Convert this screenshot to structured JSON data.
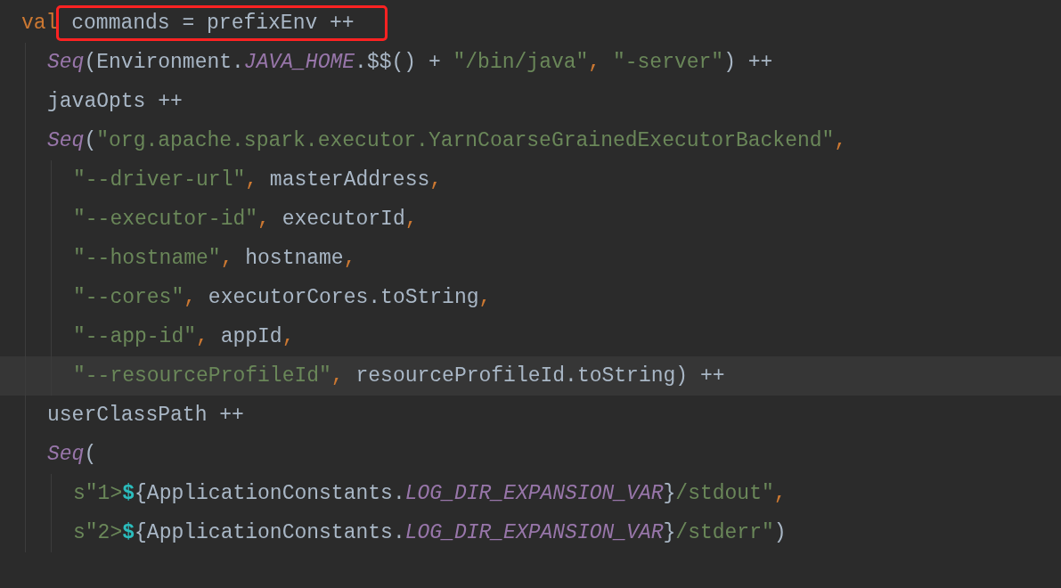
{
  "editor": {
    "lines": [
      {
        "tokens": [
          {
            "kind": "kw",
            "text": "val"
          },
          {
            "kind": "plain",
            "text": " commands = prefixEnv ++",
            "boxed": true
          }
        ],
        "children": [
          {
            "tokens": [
              {
                "kind": "fn",
                "text": "Seq"
              },
              {
                "kind": "plain",
                "text": "(Environment."
              },
              {
                "kind": "const",
                "text": "JAVA_HOME"
              },
              {
                "kind": "plain",
                "text": ".$$() + "
              },
              {
                "kind": "str",
                "text": "\"/bin/java\""
              },
              {
                "kind": "punct",
                "text": ", "
              },
              {
                "kind": "str",
                "text": "\"-server\""
              },
              {
                "kind": "plain",
                "text": ") ++"
              }
            ]
          },
          {
            "tokens": [
              {
                "kind": "plain",
                "text": "javaOpts ++"
              }
            ]
          },
          {
            "tokens": [
              {
                "kind": "fn",
                "text": "Seq"
              },
              {
                "kind": "plain",
                "text": "("
              },
              {
                "kind": "str",
                "text": "\"org.apache.spark.executor.YarnCoarseGrainedExecutorBackend\""
              },
              {
                "kind": "punct",
                "text": ","
              }
            ],
            "children": [
              {
                "tokens": [
                  {
                    "kind": "str",
                    "text": "\"--driver-url\""
                  },
                  {
                    "kind": "punct",
                    "text": ", "
                  },
                  {
                    "kind": "plain",
                    "text": "masterAddress"
                  },
                  {
                    "kind": "punct",
                    "text": ","
                  }
                ]
              },
              {
                "tokens": [
                  {
                    "kind": "str",
                    "text": "\"--executor-id\""
                  },
                  {
                    "kind": "punct",
                    "text": ", "
                  },
                  {
                    "kind": "plain",
                    "text": "executorId"
                  },
                  {
                    "kind": "punct",
                    "text": ","
                  }
                ]
              },
              {
                "tokens": [
                  {
                    "kind": "str",
                    "text": "\"--hostname\""
                  },
                  {
                    "kind": "punct",
                    "text": ", "
                  },
                  {
                    "kind": "plain",
                    "text": "hostname"
                  },
                  {
                    "kind": "punct",
                    "text": ","
                  }
                ]
              },
              {
                "tokens": [
                  {
                    "kind": "str",
                    "text": "\"--cores\""
                  },
                  {
                    "kind": "punct",
                    "text": ", "
                  },
                  {
                    "kind": "plain",
                    "text": "executorCores.toString"
                  },
                  {
                    "kind": "punct",
                    "text": ","
                  }
                ]
              },
              {
                "tokens": [
                  {
                    "kind": "str",
                    "text": "\"--app-id\""
                  },
                  {
                    "kind": "punct",
                    "text": ", "
                  },
                  {
                    "kind": "plain",
                    "text": "appId"
                  },
                  {
                    "kind": "punct",
                    "text": ","
                  }
                ]
              },
              {
                "current": true,
                "tokens": [
                  {
                    "kind": "str",
                    "text": "\"--resourceProfileId\""
                  },
                  {
                    "kind": "punct",
                    "text": ", "
                  },
                  {
                    "kind": "plain",
                    "text": "resourceProfileId.toString) ++"
                  }
                ]
              }
            ]
          },
          {
            "tokens": [
              {
                "kind": "plain",
                "text": "userClassPath ++"
              }
            ]
          },
          {
            "tokens": [
              {
                "kind": "fn",
                "text": "Seq"
              },
              {
                "kind": "plain",
                "text": "("
              }
            ],
            "children": [
              {
                "tokens": [
                  {
                    "kind": "str",
                    "text": "s\"1>"
                  },
                  {
                    "kind": "dollar",
                    "text": "$"
                  },
                  {
                    "kind": "plain",
                    "text": "{ApplicationConstants."
                  },
                  {
                    "kind": "const",
                    "text": "LOG_DIR_EXPANSION_VAR"
                  },
                  {
                    "kind": "plain",
                    "text": "}"
                  },
                  {
                    "kind": "str",
                    "text": "/stdout\""
                  },
                  {
                    "kind": "punct",
                    "text": ","
                  }
                ]
              },
              {
                "tokens": [
                  {
                    "kind": "str",
                    "text": "s\"2>"
                  },
                  {
                    "kind": "dollar",
                    "text": "$"
                  },
                  {
                    "kind": "plain",
                    "text": "{ApplicationConstants."
                  },
                  {
                    "kind": "const",
                    "text": "LOG_DIR_EXPANSION_VAR"
                  },
                  {
                    "kind": "plain",
                    "text": "}"
                  },
                  {
                    "kind": "str",
                    "text": "/stderr\""
                  },
                  {
                    "kind": "plain",
                    "text": ")"
                  }
                ]
              }
            ]
          }
        ]
      }
    ]
  }
}
